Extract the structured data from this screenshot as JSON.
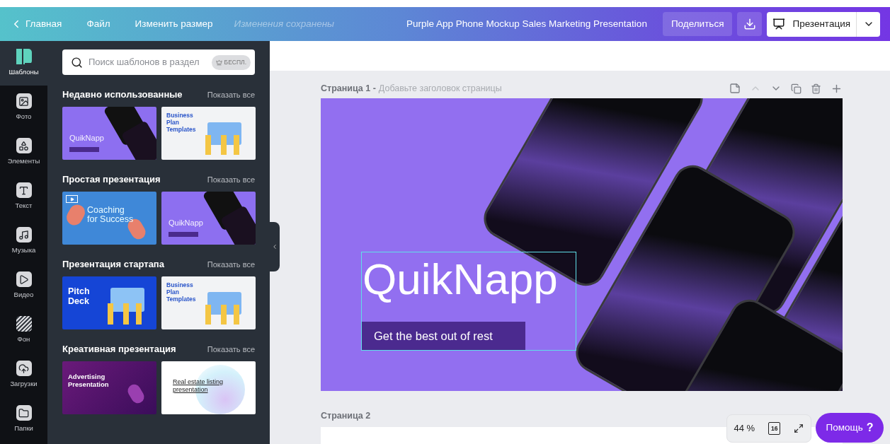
{
  "header": {
    "back": "Главная",
    "menu": [
      "Файл",
      "Изменить размер"
    ],
    "status": "Изменения сохранены",
    "title": "Purple App Phone Mockup Sales Marketing Presentation",
    "share": "Поделиться",
    "present": "Презентация"
  },
  "rail": [
    {
      "label": "Шаблоны",
      "kind": "templates",
      "selected": true
    },
    {
      "label": "Фото",
      "kind": "photo",
      "selected": false
    },
    {
      "label": "Элементы",
      "kind": "elements",
      "selected": false
    },
    {
      "label": "Текст",
      "kind": "text",
      "selected": false
    },
    {
      "label": "Музыка",
      "kind": "music",
      "selected": false
    },
    {
      "label": "Видео",
      "kind": "video",
      "selected": false
    },
    {
      "label": "Фон",
      "kind": "background",
      "selected": false
    },
    {
      "label": "Загрузки",
      "kind": "uploads",
      "selected": false
    },
    {
      "label": "Папки",
      "kind": "folders",
      "selected": false
    }
  ],
  "search": {
    "placeholder": "Поиск шаблонов в раздел",
    "badge": "БЕСПЛ."
  },
  "sections": [
    {
      "title": "Недавно использованные",
      "link": "Показать все",
      "templates": [
        {
          "kind": "phones",
          "title": "QuikNapp"
        },
        {
          "kind": "business",
          "title": "Business Plan Templates"
        }
      ]
    },
    {
      "title": "Простая презентация",
      "link": "Показать все",
      "templates": [
        {
          "kind": "coaching",
          "title": "Coaching for Success"
        },
        {
          "kind": "phones",
          "title": "QuikNapp"
        }
      ]
    },
    {
      "title": "Презентация стартапа",
      "link": "Показать все",
      "templates": [
        {
          "kind": "pitch",
          "title": "Pitch Deck"
        },
        {
          "kind": "business",
          "title": "Business Plan Templates"
        }
      ]
    },
    {
      "title": "Креативная презентация",
      "link": "Показать все",
      "templates": [
        {
          "kind": "advertising",
          "title": "Advertising Presentation"
        },
        {
          "kind": "realestate",
          "title": "Real estate listing presentation"
        }
      ]
    }
  ],
  "page1": {
    "label": "Страница 1 -",
    "hint": "Добавьте заголовок страницы"
  },
  "slide": {
    "heading": "QuikNapp",
    "button": "Get the best out of rest",
    "selected": true
  },
  "page2": {
    "label": "Страница 2"
  },
  "zoom": {
    "value": "44 %",
    "pages": "16"
  },
  "help": {
    "label": "Помощь",
    "mark": "?"
  }
}
